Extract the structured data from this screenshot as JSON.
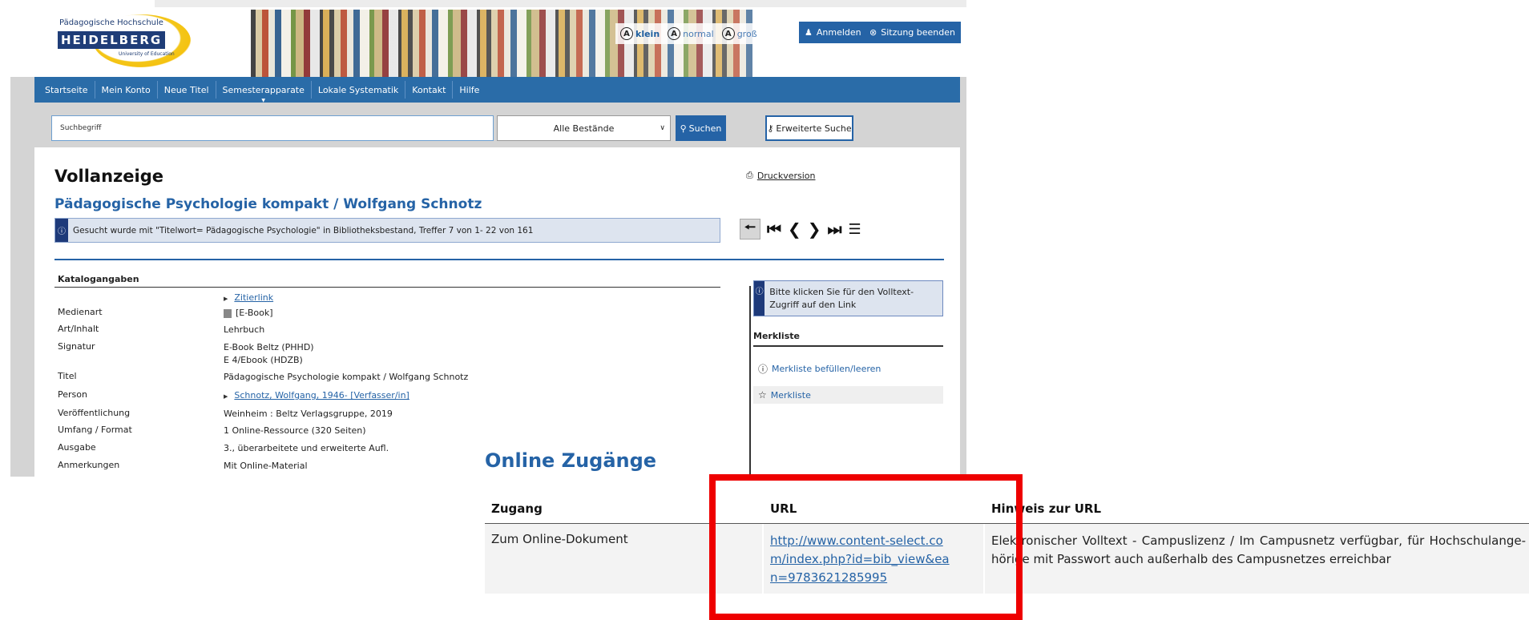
{
  "header": {
    "logo": {
      "line1": "Pädagogische Hochschule",
      "line2": "HEIDELBERG",
      "line3": "University of Education"
    },
    "font_size": {
      "small": "klein",
      "normal": "normal",
      "large": "groß"
    },
    "login_label": "Anmelden",
    "logout_label": "Sitzung beenden"
  },
  "nav": {
    "items": [
      "Startseite",
      "Mein Konto",
      "Neue Titel",
      "Semesterapparate",
      "Lokale Systematik",
      "Kontakt",
      "Hilfe"
    ]
  },
  "search": {
    "placeholder": "Suchbegriff",
    "scope": "Alle Bestände",
    "search_label": "Suchen",
    "advanced_label": "Erweiterte Suche"
  },
  "page": {
    "heading": "Vollanzeige",
    "print_label": "Druckversion",
    "title": "Pädagogische Psychologie kompakt / Wolfgang Schnotz",
    "search_info": "Gesucht wurde mit \"Titelwort= Pädagogische Psychologie\" in Bibliotheksbestand, Treffer 7 von 1- 22 von 161"
  },
  "catalog": {
    "heading": "Katalogangaben",
    "cite_link": "Zitierlink",
    "rows": [
      {
        "label": "Medienart",
        "value": "[E-Book]"
      },
      {
        "label": "Art/Inhalt",
        "value": "Lehrbuch"
      },
      {
        "label": "Signatur",
        "value": "E-Book Beltz (PHHD)",
        "value2": "E 4/Ebook (HDZB)"
      },
      {
        "label": "Titel",
        "value": "Pädagogische Psychologie kompakt / Wolfgang Schnotz"
      },
      {
        "label": "Person",
        "value": "Schnotz, Wolfgang, 1946- [Verfasser/in]"
      },
      {
        "label": "Veröffentlichung",
        "value": "Weinheim : Beltz Verlagsgruppe, 2019"
      },
      {
        "label": "Umfang / Format",
        "value": "1 Online-Ressource (320 Seiten)"
      },
      {
        "label": "Ausgabe",
        "value": "3., überarbeitete und erweiterte Aufl."
      },
      {
        "label": "Anmerkungen",
        "value": "Mit Online-Material"
      }
    ]
  },
  "sidebar": {
    "info": "Bitte klicken Sie für den Volltext-Zugriff auf den Link",
    "merkliste_heading": "Merkliste",
    "fill_label": "Merkliste befüllen/leeren",
    "list_label": "Merkliste"
  },
  "online_access": {
    "heading": "Online Zugänge",
    "columns": [
      "Zugang",
      "URL",
      "Hinweis zur URL"
    ],
    "row": {
      "access": "Zum Online-Dokument",
      "url": "http://www.content-select.com/index.php?id=bib_view&ean=9783621285995",
      "note": "Elektronischer Volltext - Campuslizenz / Im Campusnetz verfügbar, für Hochschulange-hörige mit Passwort auch außerhalb des Campusnetzes erreichbar"
    }
  },
  "colors": {
    "brand_blue": "#2563a6",
    "nav_blue": "#2a6ca8",
    "highlight_red": "#ee0000"
  }
}
